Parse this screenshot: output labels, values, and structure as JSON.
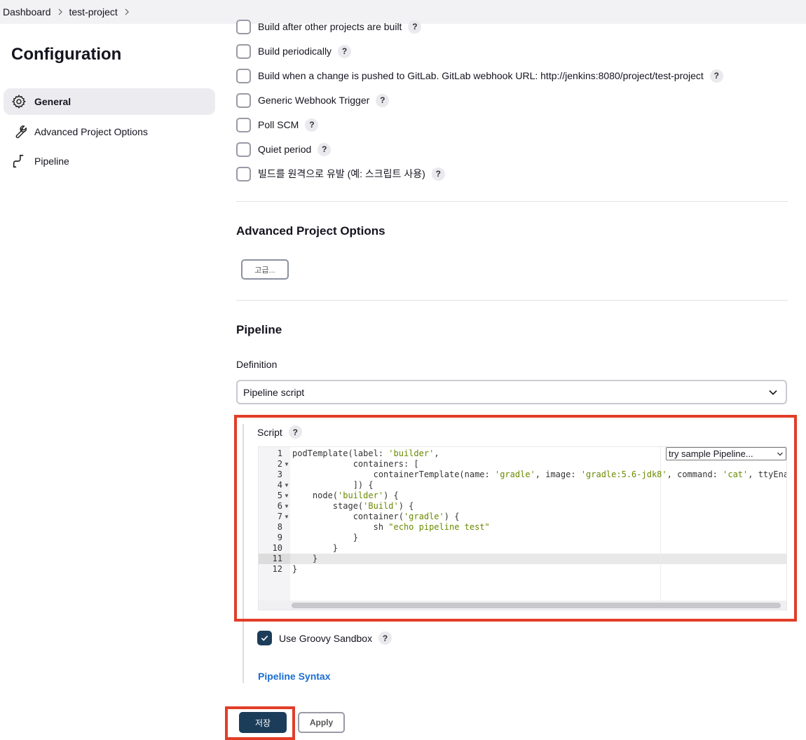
{
  "breadcrumb": {
    "items": [
      "Dashboard",
      "test-project"
    ]
  },
  "sidebar": {
    "title": "Configuration",
    "items": [
      {
        "label": "General",
        "icon": "gear-icon",
        "active": true
      },
      {
        "label": "Advanced Project Options",
        "icon": "wrench-icon",
        "active": false
      },
      {
        "label": "Pipeline",
        "icon": "pipeline-icon",
        "active": false
      }
    ]
  },
  "triggers": [
    {
      "label": "Build after other projects are built",
      "checked": false
    },
    {
      "label": "Build periodically",
      "checked": false
    },
    {
      "label": "Build when a change is pushed to GitLab. GitLab webhook URL: http://jenkins:8080/project/test-project",
      "checked": false
    },
    {
      "label": "Generic Webhook Trigger",
      "checked": false
    },
    {
      "label": "Poll SCM",
      "checked": false
    },
    {
      "label": "Quiet period",
      "checked": false
    },
    {
      "label": "빌드를 원격으로 유발 (예: 스크립트 사용)",
      "checked": false
    }
  ],
  "help_label": "?",
  "advanced": {
    "title": "Advanced Project Options",
    "button_label": "고급..."
  },
  "pipeline": {
    "title": "Pipeline",
    "definition_label": "Definition",
    "definition_value": "Pipeline script",
    "script_label": "Script",
    "sample_select": "try sample Pipeline...",
    "line_numbers": [
      "1",
      "2",
      "3",
      "4",
      "5",
      "6",
      "7",
      "8",
      "9",
      "10",
      "11",
      "12"
    ],
    "groovy_sandbox_label": "Use Groovy Sandbox",
    "groovy_sandbox_checked": true,
    "pipeline_syntax_link": "Pipeline Syntax"
  },
  "actions": {
    "save_label": "저장",
    "apply_label": "Apply"
  },
  "colors": {
    "primary": "#1c3d5a",
    "highlight": "#e23d28",
    "link": "#1c6dd0"
  }
}
